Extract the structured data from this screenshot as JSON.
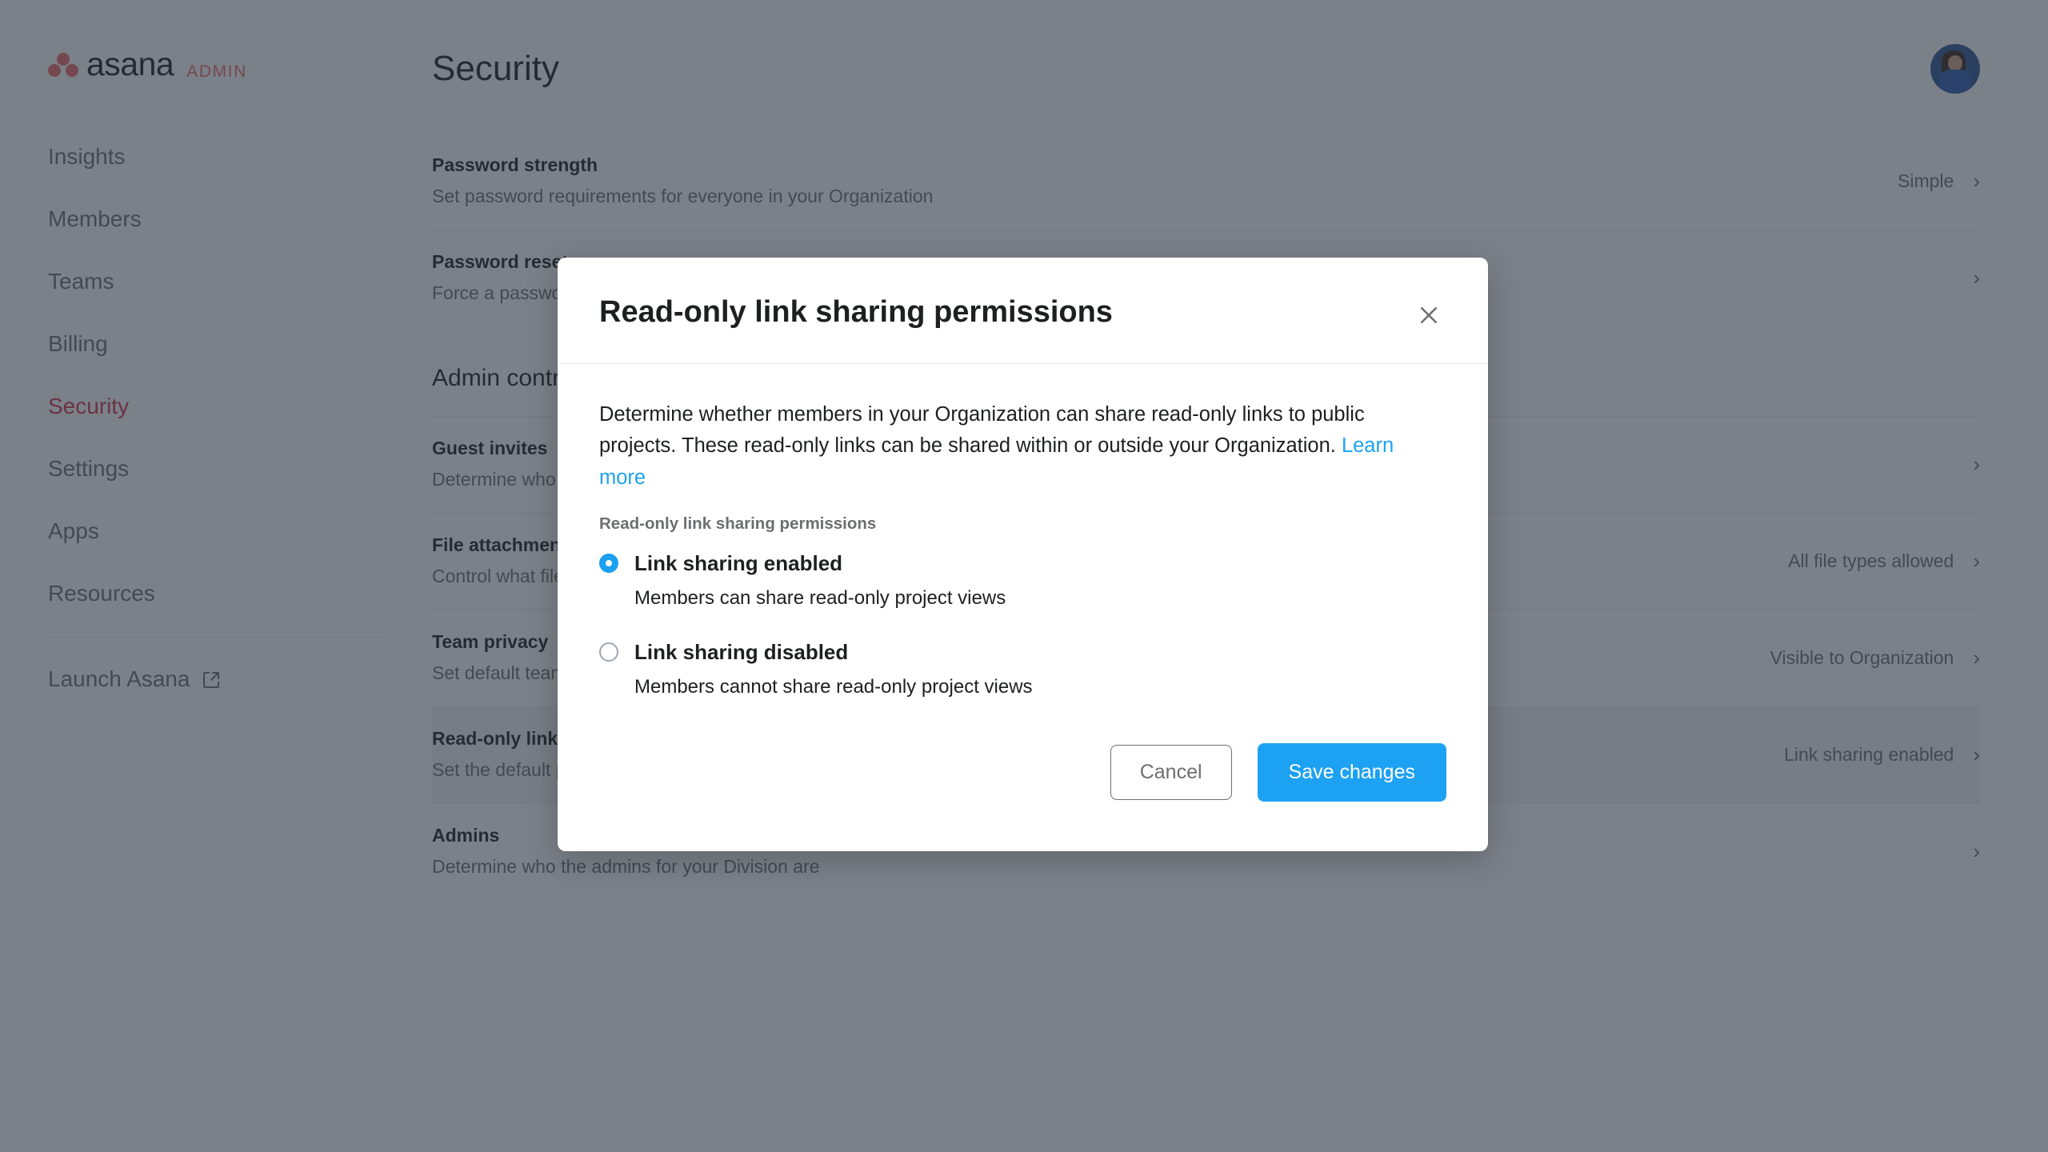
{
  "brand": {
    "wordmark": "asana",
    "admin_tag": "ADMIN",
    "logo_color": "#f06a6a"
  },
  "sidebar": {
    "items": [
      {
        "label": "Insights",
        "active": false
      },
      {
        "label": "Members",
        "active": false
      },
      {
        "label": "Teams",
        "active": false
      },
      {
        "label": "Billing",
        "active": false
      },
      {
        "label": "Security",
        "active": true
      },
      {
        "label": "Settings",
        "active": false
      },
      {
        "label": "Apps",
        "active": false
      },
      {
        "label": "Resources",
        "active": false
      }
    ],
    "launch": {
      "label": "Launch Asana",
      "icon": "external-link-icon"
    },
    "active_color": "#d1344a"
  },
  "header": {
    "title": "Security",
    "avatar": "user-avatar"
  },
  "main": {
    "section_heading": "Admin controls",
    "rows_top": [
      {
        "title": "Password strength",
        "desc": "Set password requirements for everyone in your Organization",
        "value": "Simple"
      },
      {
        "title": "Password reset",
        "desc": "Force a password reset for everyone in your Organization",
        "value": ""
      }
    ],
    "rows_bottom": [
      {
        "title": "Guest invites",
        "desc": "Determine who can invite guests to your Organization",
        "value": "",
        "highlight": false
      },
      {
        "title": "File attachments",
        "desc": "Control what file types can be attached",
        "value": "All file types allowed",
        "highlight": false
      },
      {
        "title": "Team privacy",
        "desc": "Set default team privacy for your Organization",
        "value": "Visible to Organization",
        "highlight": false
      },
      {
        "title": "Read-only link sharing permissions",
        "desc": "Set the default permission on sharing project views within or outside your Organization",
        "value": "Link sharing enabled",
        "highlight": true
      },
      {
        "title": "Admins",
        "desc": "Determine who the admins for your Division are",
        "value": "",
        "highlight": false
      }
    ],
    "chevron": "›"
  },
  "modal": {
    "title": "Read-only link sharing permissions",
    "close_icon": "close-icon",
    "description_part1": "Determine whether members in your Organization can share read-only links to public projects. These read-only links can be shared within or outside your Organization. ",
    "learn_more": "Learn more",
    "field_label": "Read-only link sharing permissions",
    "options": [
      {
        "label": "Link sharing enabled",
        "sublabel": "Members can share read-only project views",
        "selected": true
      },
      {
        "label": "Link sharing disabled",
        "sublabel": "Members cannot share read-only project views",
        "selected": false
      }
    ],
    "cancel_label": "Cancel",
    "save_label": "Save changes",
    "accent_color": "#1da1f2"
  }
}
